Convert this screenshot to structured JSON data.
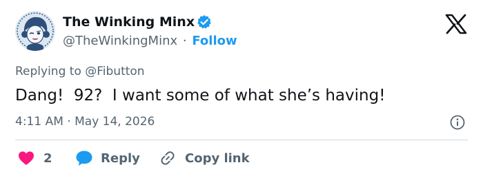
{
  "post": {
    "author": {
      "name": "The Winking Minx",
      "handle": "@TheWinkingMinx",
      "separator": "·",
      "follow_label": "Follow",
      "verified": true
    },
    "reply_context": {
      "prefix": "Replying to",
      "mention": "@Fibutton"
    },
    "text": "Dang!  92?  I want some of what she’s having!",
    "meta": {
      "time": "4:11 AM",
      "separator": "·",
      "date": "May 14, 2026"
    },
    "actions": {
      "likes_count": "2",
      "reply_label": "Reply",
      "copy_link_label": "Copy link"
    }
  },
  "icons": {
    "verified": "verified-badge-icon",
    "brand": "x-logo-icon",
    "info": "info-icon",
    "like": "heart-icon",
    "reply": "speech-bubble-icon",
    "copy": "link-icon"
  },
  "colors": {
    "accent": "#1d9bf0",
    "like": "#f91880",
    "text": "#0f1419",
    "muted": "#536471",
    "divider": "#cfd9de"
  }
}
